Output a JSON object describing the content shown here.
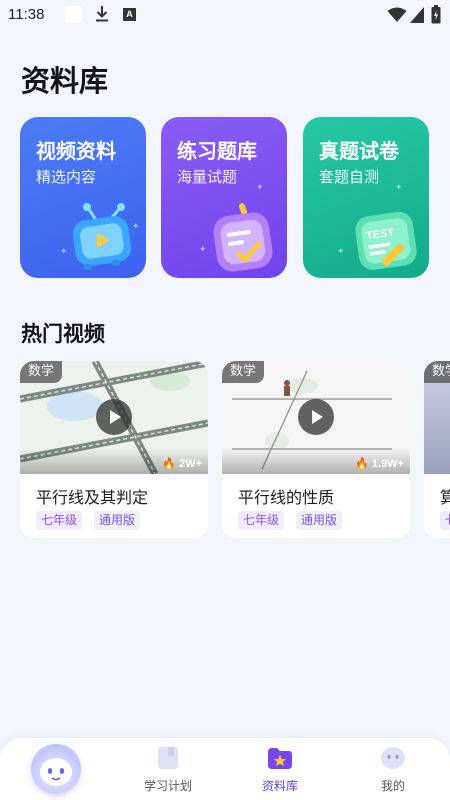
{
  "status_bar": {
    "time": "11:38",
    "a_glyph": "A"
  },
  "page": {
    "title": "资料库"
  },
  "categories": [
    {
      "title": "视频资料",
      "subtitle": "精选内容",
      "icon": "tv-play-icon",
      "color": "#4a75f5"
    },
    {
      "title": "练习题库",
      "subtitle": "海量试题",
      "icon": "checklist-icon",
      "color": "#8055f0"
    },
    {
      "title": "真题试卷",
      "subtitle": "套题自测",
      "icon": "test-paper-icon",
      "color": "#1dba99",
      "badge": "TEST"
    }
  ],
  "hot_videos": {
    "title": "热门视频",
    "items": [
      {
        "subject": "数学",
        "views": "2W+",
        "title": "平行线及其判定",
        "grade": "七年级",
        "edition": "通用版"
      },
      {
        "subject": "数学",
        "views": "1.9W+",
        "title": "平行线的性质",
        "grade": "七年级",
        "edition": "通用版"
      },
      {
        "subject": "数学",
        "title": "算",
        "grade": "七"
      }
    ]
  },
  "bottom_nav": {
    "items": [
      {
        "label": "学习计划",
        "icon": "book-icon",
        "active": false
      },
      {
        "label": "资料库",
        "icon": "folder-star-icon",
        "active": true
      },
      {
        "label": "我的",
        "icon": "profile-face-icon",
        "active": false
      }
    ]
  },
  "colors": {
    "accent": "#6b3fe6",
    "background": "#f3f5fc"
  }
}
